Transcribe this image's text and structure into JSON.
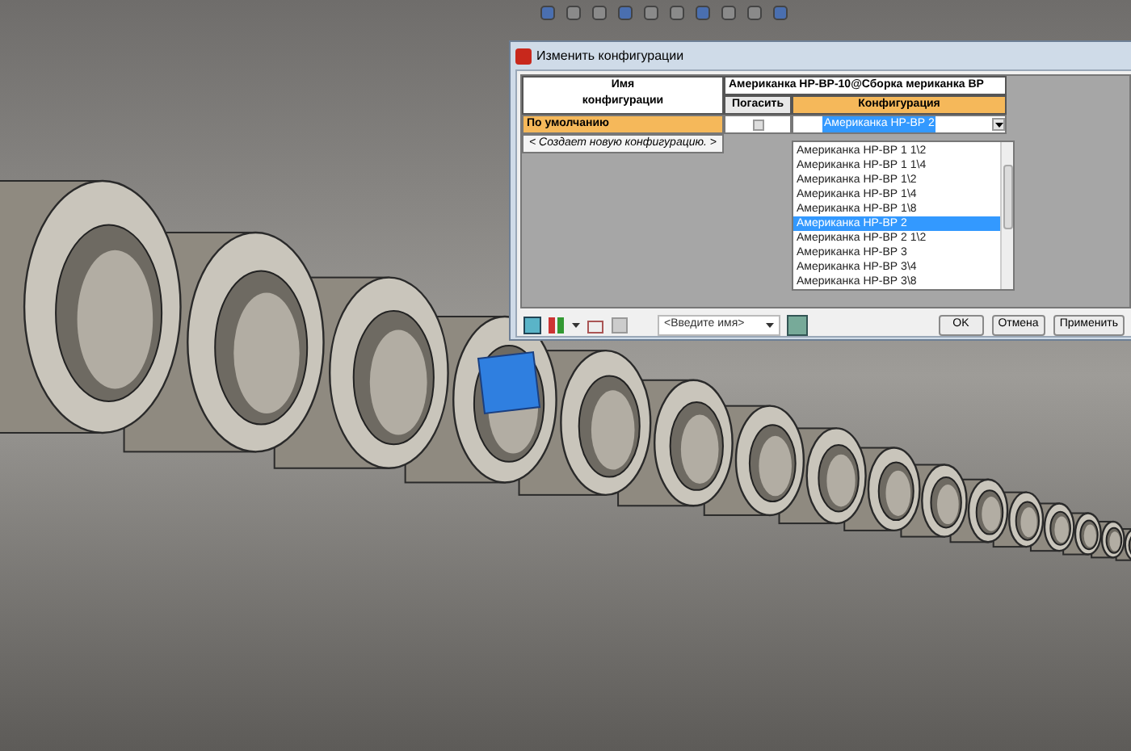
{
  "dialog": {
    "title": "Изменить конфигурации",
    "table": {
      "name_header": "Имя\nконфигурации",
      "assembly_header": "Американка НР-ВР-10@Сборка мериканка ВР",
      "suppress_header": "Погасить",
      "config_header": "Конфигурация",
      "rows": [
        {
          "kind": "config",
          "name": "По умолчанию",
          "selected": true,
          "suppressed": false,
          "configuration": "Американка НР-ВР 2"
        },
        {
          "kind": "new",
          "name": "< Создает новую конфигурацию. >"
        }
      ]
    },
    "dropdown": {
      "options": [
        {
          "label": "Американка НР-ВР 1 1\\2",
          "selected": false
        },
        {
          "label": "Американка НР-ВР 1 1\\4",
          "selected": false
        },
        {
          "label": "Американка НР-ВР 1\\2",
          "selected": false
        },
        {
          "label": "Американка НР-ВР 1\\4",
          "selected": false
        },
        {
          "label": "Американка НР-ВР 1\\8",
          "selected": false
        },
        {
          "label": "Американка НР-ВР 2",
          "selected": true
        },
        {
          "label": "Американка НР-ВР 2 1\\2",
          "selected": false
        },
        {
          "label": "Американка НР-ВР 3",
          "selected": false
        },
        {
          "label": "Американка НР-ВР 3\\4",
          "selected": false
        },
        {
          "label": "Американка НР-ВР 3\\8",
          "selected": false
        }
      ]
    },
    "name_field": {
      "placeholder": "<Введите имя>"
    },
    "buttons": [
      "OK",
      "Отмена",
      "Применить"
    ]
  }
}
